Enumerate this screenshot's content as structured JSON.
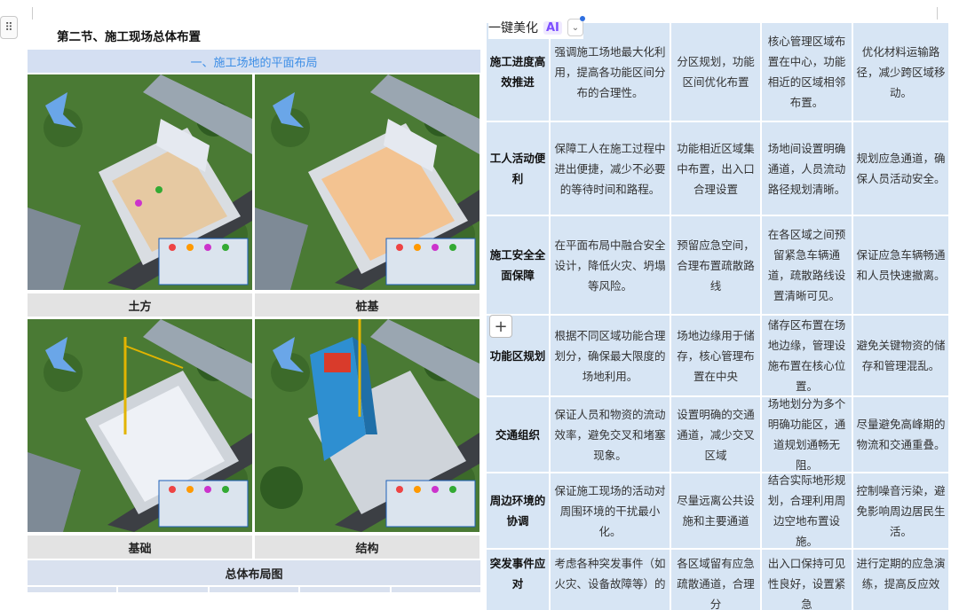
{
  "document": {
    "section_title": "第二节、施工现场总体布置",
    "subheading": "一、施工场地的平面布局",
    "photos": [
      {
        "caption": "土方"
      },
      {
        "caption": "桩基"
      },
      {
        "caption": "基础"
      },
      {
        "caption": "结构"
      }
    ],
    "layout_caption": "总体布局图"
  },
  "toolbar": {
    "beautify_label": "一键美化",
    "ai_badge": "AI",
    "chevron": "⌄",
    "drag_handle": "⠿",
    "plus": "+"
  },
  "table": {
    "rows": [
      {
        "head": "施工进度高效推进",
        "cells": [
          "强调施工场地最大化利用，提高各功能区间分布的合理性。",
          "分区规划，功能区间优化布置",
          "核心管理区域布置在中心，功能相近的区域相邻布置。",
          "优化材料运输路径，减少跨区域移动。"
        ]
      },
      {
        "head": "工人活动便利",
        "cells": [
          "保障工人在施工过程中进出便捷，减少不必要的等待时间和路程。",
          "功能相近区域集中布置，出入口合理设置",
          "场地间设置明确通道，人员流动路径规划清晰。",
          "规划应急通道，确保人员活动安全。"
        ]
      },
      {
        "head": "施工安全全面保障",
        "cells": [
          "在平面布局中融合安全设计，降低火灾、坍塌等风险。",
          "预留应急空间，合理布置疏散路线",
          "在各区域之间预留紧急车辆通道，疏散路线设置清晰可见。",
          "保证应急车辆畅通和人员快速撤离。"
        ]
      },
      {
        "head": "功能区规划",
        "cells": [
          "根据不同区域功能合理划分，确保最大限度的场地利用。",
          "场地边缘用于储存，核心管理布置在中央",
          "储存区布置在场地边缘，管理设施布置在核心位置。",
          "避免关键物资的储存和管理混乱。"
        ]
      },
      {
        "head": "交通组织",
        "cells": [
          "保证人员和物资的流动效率，避免交叉和堵塞现象。",
          "设置明确的交通通道，减少交叉区域",
          "场地划分为多个明确功能区，通道规划通畅无阻。",
          "尽量避免高峰期的物流和交通重叠。"
        ]
      },
      {
        "head": "周边环境的协调",
        "cells": [
          "保证施工现场的活动对周围环境的干扰最小化。",
          "尽量远离公共设施和主要通道",
          "结合实际地形规划，合理利用周边空地布置设施。",
          "控制噪音污染，避免影响周边居民生活。"
        ]
      },
      {
        "head": "突发事件应对",
        "cells": [
          "考虑各种突发事件（如火灾、设备故障等）的",
          "各区域留有应急疏散通道，合理分",
          "出入口保持可见性良好，设置紧急",
          "进行定期的应急演练，提高反应效"
        ]
      }
    ]
  },
  "colors": {
    "band_bg": "#d4dff2",
    "band_text": "#3d8ee6",
    "table_cell_bg": "#d7e5f4",
    "caption_bg": "#e3e3e3",
    "ai_purple": "#7c4dff"
  }
}
